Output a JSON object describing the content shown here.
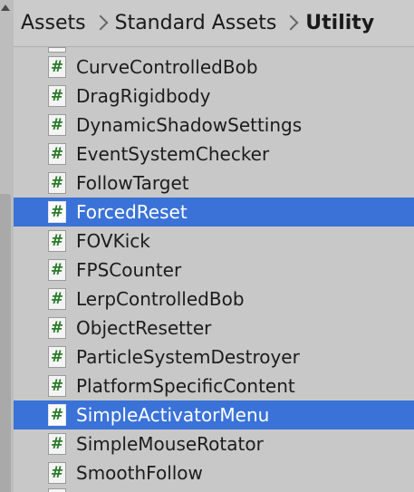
{
  "breadcrumb": {
    "items": [
      "Assets",
      "Standard Assets"
    ],
    "current": "Utility"
  },
  "icons": {
    "rail_arrow": "scroll-up-arrow-icon",
    "script": "csharp-script-icon",
    "script_glyph": "#",
    "separator": "chevron-right-icon"
  },
  "colors": {
    "selection": "#3a72d8",
    "script_glyph": "#2b7a2b",
    "background": "#c8c8c8"
  },
  "files": [
    {
      "name": "CurveControlledBob",
      "selected": false
    },
    {
      "name": "DragRigidbody",
      "selected": false
    },
    {
      "name": "DynamicShadowSettings",
      "selected": false
    },
    {
      "name": "EventSystemChecker",
      "selected": false
    },
    {
      "name": "FollowTarget",
      "selected": false
    },
    {
      "name": "ForcedReset",
      "selected": true
    },
    {
      "name": "FOVKick",
      "selected": false
    },
    {
      "name": "FPSCounter",
      "selected": false
    },
    {
      "name": "LerpControlledBob",
      "selected": false
    },
    {
      "name": "ObjectResetter",
      "selected": false
    },
    {
      "name": "ParticleSystemDestroyer",
      "selected": false
    },
    {
      "name": "PlatformSpecificContent",
      "selected": false
    },
    {
      "name": "SimpleActivatorMenu",
      "selected": true
    },
    {
      "name": "SimpleMouseRotator",
      "selected": false
    },
    {
      "name": "SmoothFollow",
      "selected": false
    }
  ]
}
